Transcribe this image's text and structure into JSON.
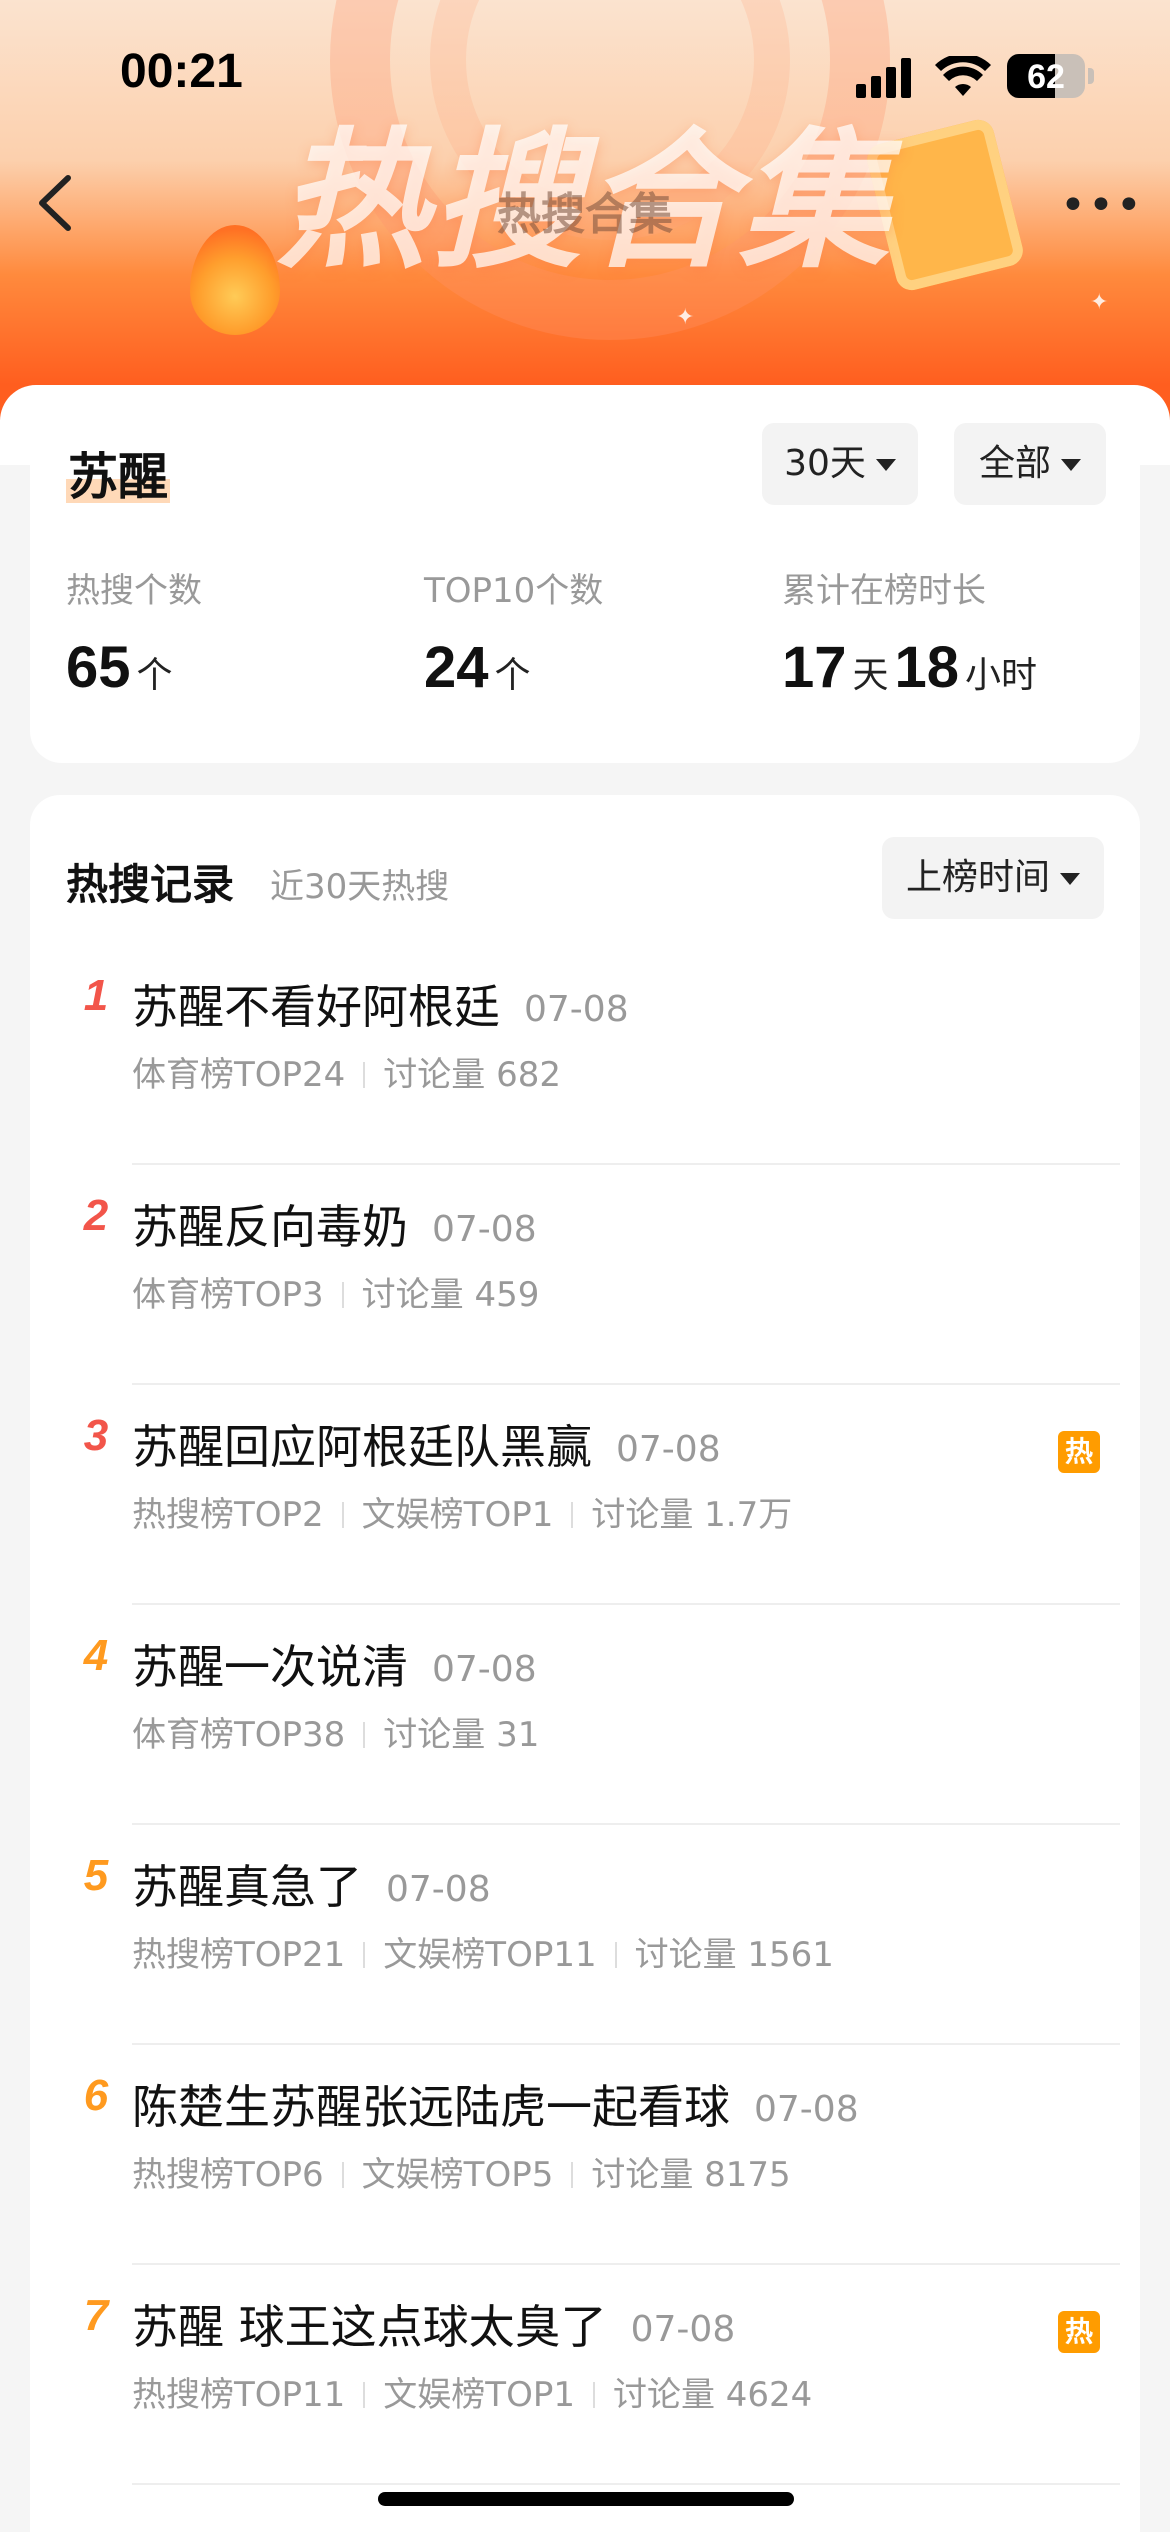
{
  "status_bar": {
    "time": "00:21",
    "battery": "62",
    "battery_level": 0.62
  },
  "header": {
    "banner_title": "热搜合集",
    "nav_title": "热搜合集",
    "more_label": "•••"
  },
  "summary": {
    "keyword": "苏醒",
    "period_filter": "30天",
    "category_filter": "全部",
    "stats": [
      {
        "label": "热搜个数",
        "value": "65",
        "unit": "个"
      },
      {
        "label": "TOP10个数",
        "value": "24",
        "unit": "个"
      },
      {
        "label": "累计在榜时长",
        "value1": "17",
        "unit1": "天",
        "value2": "18",
        "unit2": "小时"
      }
    ]
  },
  "records": {
    "title": "热搜记录",
    "subtitle": "近30天热搜",
    "sort_label": "上榜时间",
    "hot_badge": "热",
    "items": [
      {
        "rank": "1",
        "title": "苏醒不看好阿根廷",
        "date": "07-08",
        "meta": [
          "体育榜TOP24",
          "讨论量 682"
        ],
        "hot": false,
        "rank_color": "#f2554a"
      },
      {
        "rank": "2",
        "title": "苏醒反向毒奶",
        "date": "07-08",
        "meta": [
          "体育榜TOP3",
          "讨论量 459"
        ],
        "hot": false,
        "rank_color": "#f2554a"
      },
      {
        "rank": "3",
        "title": "苏醒回应阿根廷队黑赢",
        "date": "07-08",
        "meta": [
          "热搜榜TOP2",
          "文娱榜TOP1",
          "讨论量 1.7万"
        ],
        "hot": true,
        "rank_color": "#f2554a"
      },
      {
        "rank": "4",
        "title": "苏醒一次说清",
        "date": "07-08",
        "meta": [
          "体育榜TOP38",
          "讨论量 31"
        ],
        "hot": false,
        "rank_color": "#ff9a1f"
      },
      {
        "rank": "5",
        "title": "苏醒真急了",
        "date": "07-08",
        "meta": [
          "热搜榜TOP21",
          "文娱榜TOP11",
          "讨论量 1561"
        ],
        "hot": false,
        "rank_color": "#ff9a1f"
      },
      {
        "rank": "6",
        "title": "陈楚生苏醒张远陆虎一起看球",
        "date": "07-08",
        "meta": [
          "热搜榜TOP6",
          "文娱榜TOP5",
          "讨论量 8175"
        ],
        "hot": false,
        "rank_color": "#ff9a1f"
      },
      {
        "rank": "7",
        "title": "苏醒 球王这点球太臭了",
        "date": "07-08",
        "meta": [
          "热搜榜TOP11",
          "文娱榜TOP1",
          "讨论量 4624"
        ],
        "hot": true,
        "rank_color": "#ff9a1f"
      }
    ]
  },
  "colors": {
    "accent": "#ff5e1f",
    "hot_badge": "#ff9c00",
    "rank_top": "#f2554a",
    "rank_other": "#ff9a1f"
  }
}
